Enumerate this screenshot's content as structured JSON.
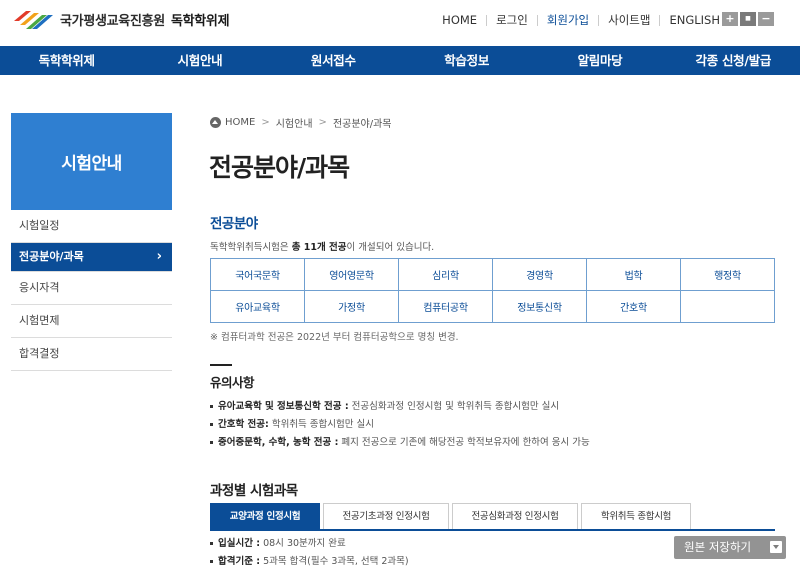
{
  "header": {
    "org_name": "국가평생교육진흥원",
    "site_name": "독학학위제",
    "util_links": [
      "HOME",
      "로그인",
      "회원가입",
      "사이트맵",
      "ENGLISH"
    ],
    "zoom_in": "+",
    "zoom_reset": "■",
    "zoom_out": "−"
  },
  "nav": {
    "items": [
      "독학학위제",
      "시험안내",
      "원서접수",
      "학습정보",
      "알림마당",
      "각종 신청/발급"
    ]
  },
  "sidebar": {
    "title": "시험안내",
    "items": [
      "시험일정",
      "전공분야/과목",
      "응시자격",
      "시험면제",
      "합격결정"
    ],
    "active_chevron": "›"
  },
  "breadcrumb": {
    "home": "HOME",
    "level1": "시험안내",
    "level2": "전공분야/과목",
    "sep": ">"
  },
  "page": {
    "title": "전공분야/과목"
  },
  "majors_section": {
    "heading": "전공분야",
    "desc_prefix": "독학학위취득시험은 ",
    "desc_bold": "총 11개 전공",
    "desc_suffix": "이 개설되어 있습니다.",
    "rows": [
      [
        "국어국문학",
        "영어영문학",
        "심리학",
        "경영학",
        "법학",
        "행정학"
      ],
      [
        "유아교육학",
        "가정학",
        "컴퓨터공학",
        "정보통신학",
        "간호학",
        ""
      ]
    ],
    "note": "※ 컴퓨터과학 전공은 2022년 부터 컴퓨터공학으로 명칭 변경."
  },
  "caution": {
    "heading": "유의사항",
    "items": [
      {
        "bold": "유아교육학 및 정보통신학 전공 :",
        "text": " 전공심화과정 인정시험 및 학위취득 종합시험만 실시"
      },
      {
        "bold": "간호학 전공:",
        "text": " 학위취득 종합시험만 실시"
      },
      {
        "bold": "중어중문학, 수학, 농학 전공 :",
        "text": " 폐지 전공으로 기존에 해당전공 학적보유자에 한하여 응시 가능"
      }
    ]
  },
  "courses": {
    "heading": "과정별 시험과목",
    "tabs": [
      "교양과정 인정시험",
      "전공기초과정 인정시험",
      "전공심화과정 인정시험",
      "학위취득 종합시험"
    ],
    "items": [
      {
        "bold": "입실시간 :",
        "text": " 08시 30분까지 완료"
      },
      {
        "bold": "합격기준 :",
        "text": " 5과목 합격(필수 3과목, 선택 2과목)"
      }
    ]
  },
  "save_button": {
    "label": "원본 저장하기"
  },
  "colors": {
    "brand": "#0b4d97",
    "sidebar_title": "#2f7fd1",
    "table_border": "#6f9fd0"
  }
}
